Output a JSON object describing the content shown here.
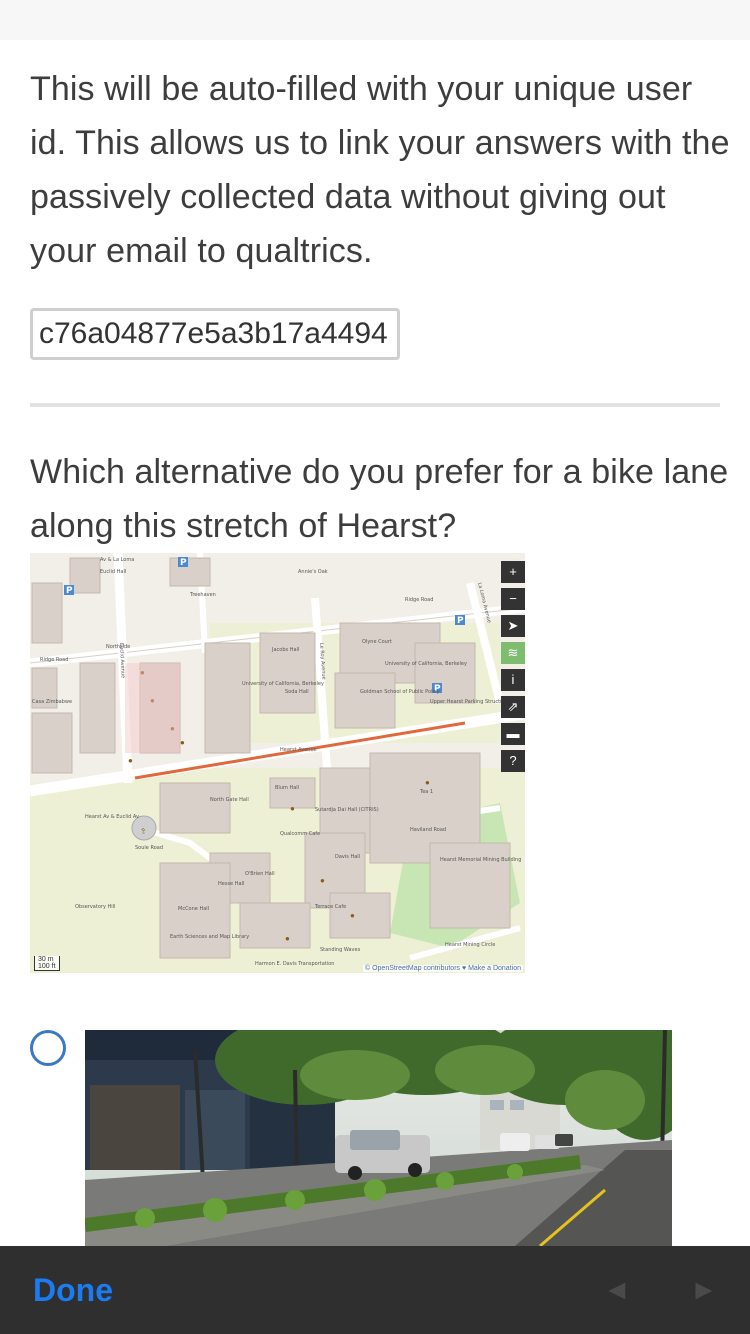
{
  "question1": {
    "text": "This will be auto-filled with your unique user id. This allows us to link your answers with the passively collected data without giving out your email to qualtrics.",
    "user_id_value": "c76a04877e5a3b17a4494"
  },
  "question2": {
    "text": "Which alternative do you prefer for a bike lane along this stretch of Hearst?"
  },
  "map": {
    "labels": {
      "ridge_road_w": "Ridge Road",
      "ridge_road_e": "Ridge Road",
      "euclid_ave": "Euclid Avenue",
      "le_roy_ave": "Le Roy Avenue",
      "la_loma_ave": "La Loma Avenue",
      "hearst_ave": "Hearst Avenue",
      "soule_road": "Soule Road",
      "haviland_road": "Haviland Road",
      "hearst_mining_circle": "Hearst Mining Circle",
      "northside": "Northside",
      "treehaven": "Treehaven",
      "jacobs_hall": "Jacobs Hall",
      "uc_berkeley_w": "University of California, Berkeley",
      "uc_berkeley_e": "University of California, Berkeley",
      "soda_hall": "Soda Hall",
      "upper_hearst_parking": "Upper Hearst Parking Structure",
      "goldman_school": "Goldman School of Public Policy",
      "olyne_court": "Olyne Court",
      "blum_hall": "Blum Hall",
      "sutardja_dai_hall": "Sutardja Dai Hall (CITRIS)",
      "north_gate_hall": "North Gate Hall",
      "davis_hall": "Davis Hall",
      "obrien_hall": "O'Brien Hall",
      "hesse_hall": "Hesse Hall",
      "mccone_hall": "McCone Hall",
      "earth_sciences_library": "Earth Sciences and Map Library",
      "hearst_memorial_mining": "Hearst Memorial Mining Building",
      "observatory_hill": "Observatory Hill",
      "qualcomm_cafe": "Qualcomm Cafe",
      "terrace_cafe": "Terrace Cafe",
      "standing_waves": "Standing Waves",
      "harmon_davis_transportation": "Harmon E. Davis Transportation",
      "casa_zimbabwe": "Casa Zimbabwe",
      "euclid_apts": "Euclid Hall",
      "hearst_euclid": "Hearst Av & Euclid Av",
      "av_la_loma": "Av & La Loma",
      "tea_1": "Tea 1",
      "annies_oak": "Annie's Oak"
    },
    "controls": [
      "+",
      "−",
      "➤",
      "≋",
      "i",
      "⇗",
      "▬",
      "?"
    ],
    "attribution": "© OpenStreetMap contributors ♥ Make a Donation",
    "scale_m": "30 m",
    "scale_ft": "100 ft"
  },
  "toolbar": {
    "done_label": "Done",
    "prev_arrow": "◄",
    "next_arrow": "►"
  }
}
